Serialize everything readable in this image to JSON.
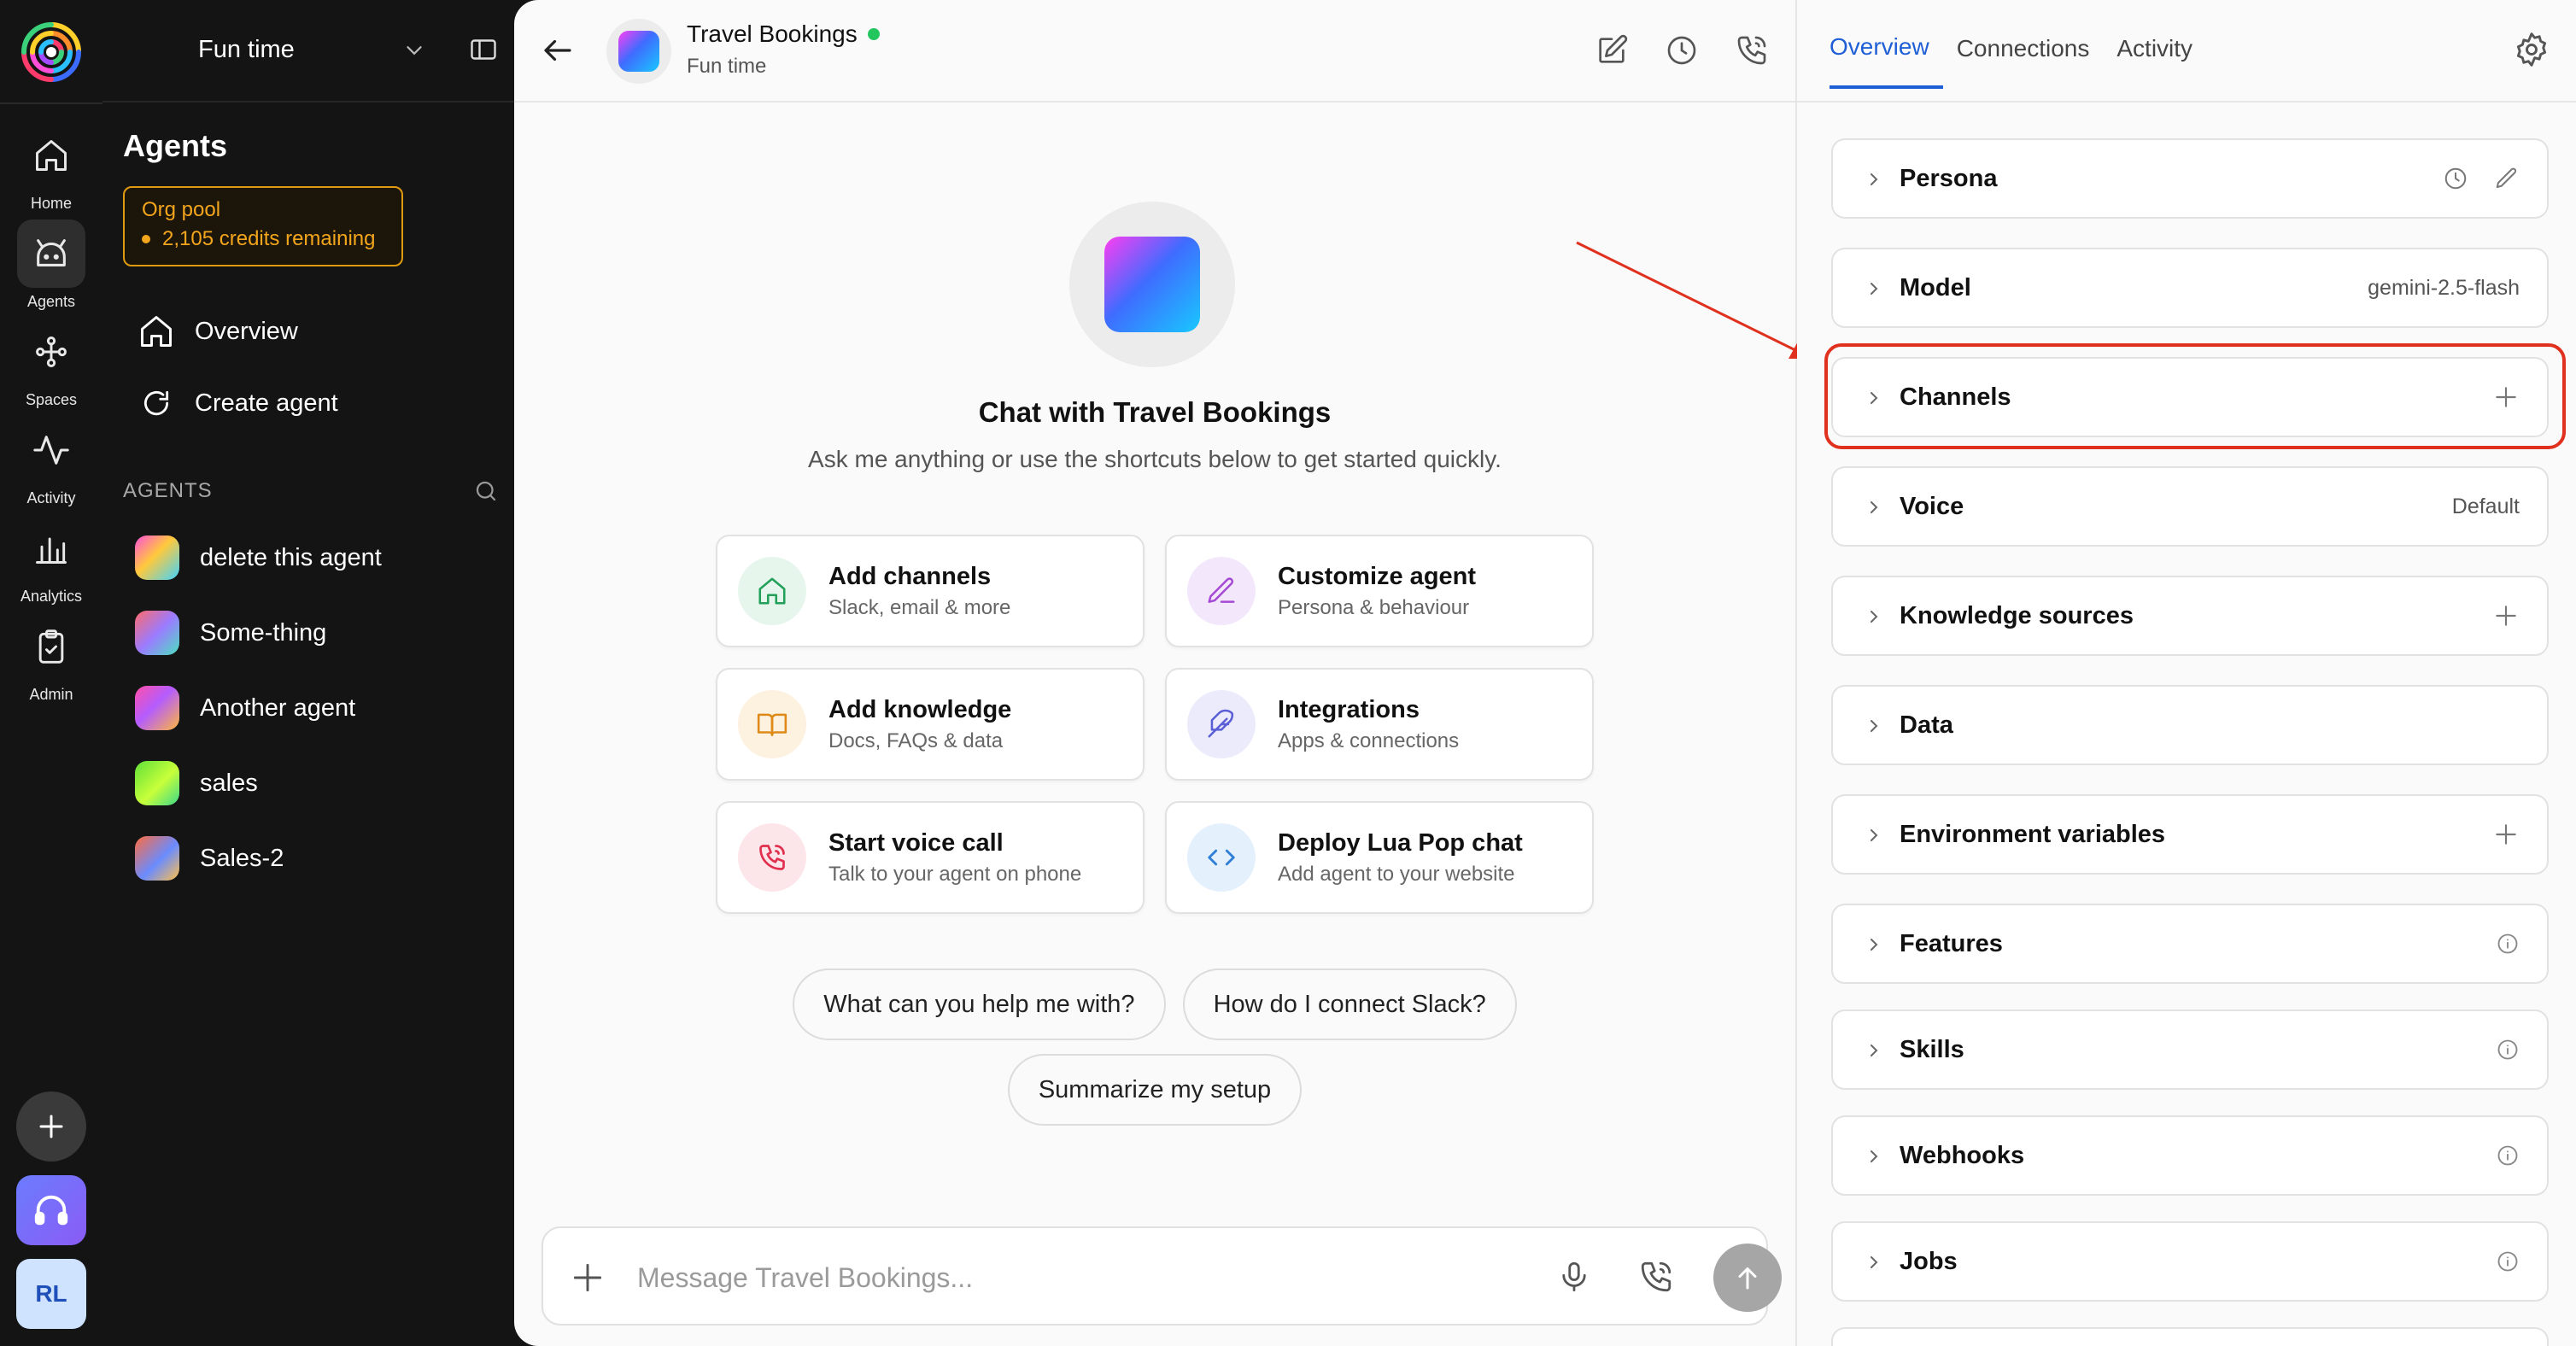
{
  "workspace": {
    "name": "Fun time"
  },
  "rail": {
    "items": [
      {
        "label": "Home",
        "icon": "home-icon"
      },
      {
        "label": "Agents",
        "icon": "bot-icon"
      },
      {
        "label": "Spaces",
        "icon": "spaces-icon"
      },
      {
        "label": "Activity",
        "icon": "activity-icon"
      },
      {
        "label": "Analytics",
        "icon": "bar-chart-icon"
      },
      {
        "label": "Admin",
        "icon": "clipboard-icon"
      }
    ],
    "avatar_initials": "RL"
  },
  "sidebar": {
    "title": "Agents",
    "org_pool": {
      "title": "Org pool",
      "credits": "2,105 credits remaining"
    },
    "nav": [
      {
        "label": "Overview",
        "icon": "home-icon"
      },
      {
        "label": "Create agent",
        "icon": "refresh-icon"
      }
    ],
    "section_label": "AGENTS",
    "agents": [
      {
        "name": "delete this agent",
        "gradient": "linear-gradient(135deg,#ff4fd8,#ffc93c 45%,#3fd3ff)"
      },
      {
        "name": "Some-thing",
        "gradient": "linear-gradient(135deg,#ff6a6a,#9b7bff 50%,#4ce0c0)"
      },
      {
        "name": "Another agent",
        "gradient": "linear-gradient(135deg,#ff4fa8,#b45cff 45%,#ffb83c)"
      },
      {
        "name": "sales",
        "gradient": "linear-gradient(135deg,#5fe03a,#c8ff3a 55%,#3ad88a)"
      },
      {
        "name": "Sales-2",
        "gradient": "linear-gradient(135deg,#ff6b3d,#6a8bff 55%,#ffc14a)"
      }
    ]
  },
  "chat": {
    "agent_name": "Travel Bookings",
    "workspace": "Fun time",
    "status_color": "#22c55e",
    "hero_title": "Chat with Travel Bookings",
    "hero_subtitle": "Ask me anything or use the shortcuts below to get started quickly.",
    "cards": [
      {
        "title": "Add channels",
        "subtitle": "Slack, email & more",
        "icon": "home-icon",
        "bg": "#e6f6ec",
        "fg": "#22a05a"
      },
      {
        "title": "Customize agent",
        "subtitle": "Persona & behaviour",
        "icon": "pencil-icon",
        "bg": "#f3e8fb",
        "fg": "#a64ad6"
      },
      {
        "title": "Add knowledge",
        "subtitle": "Docs, FAQs & data",
        "icon": "book-icon",
        "bg": "#fdf1df",
        "fg": "#dd8a18"
      },
      {
        "title": "Integrations",
        "subtitle": "Apps & connections",
        "icon": "feather-icon",
        "bg": "#ecebfb",
        "fg": "#5b5fd6"
      },
      {
        "title": "Start voice call",
        "subtitle": "Talk to your agent on phone",
        "icon": "phone-icon",
        "bg": "#fde6ea",
        "fg": "#e0304e"
      },
      {
        "title": "Deploy Lua Pop chat",
        "subtitle": "Add agent to your website",
        "icon": "code-icon",
        "bg": "#e4f1fd",
        "fg": "#2f7fd6"
      }
    ],
    "chips_row1": [
      "What can you help me with?",
      "How do I connect Slack?"
    ],
    "chips_row2": [
      "Summarize my setup"
    ],
    "composer_placeholder": "Message Travel Bookings..."
  },
  "right_panel": {
    "tabs": [
      "Overview",
      "Connections",
      "Activity"
    ],
    "active_tab": "Overview",
    "sections": [
      {
        "title": "Persona",
        "right": "",
        "icons": [
          "history-icon",
          "pencil-icon"
        ]
      },
      {
        "title": "Model",
        "right": "gemini-2.5-flash",
        "icons": []
      },
      {
        "title": "Channels",
        "right": "",
        "icons": [
          "plus-icon"
        ]
      },
      {
        "title": "Voice",
        "right": "Default",
        "icons": []
      },
      {
        "title": "Knowledge sources",
        "right": "",
        "icons": [
          "plus-icon"
        ]
      },
      {
        "title": "Data",
        "right": "",
        "icons": []
      },
      {
        "title": "Environment variables",
        "right": "",
        "icons": [
          "plus-icon"
        ]
      },
      {
        "title": "Features",
        "right": "",
        "icons": [
          "info-icon"
        ]
      },
      {
        "title": "Skills",
        "right": "",
        "icons": [
          "info-icon"
        ]
      },
      {
        "title": "Webhooks",
        "right": "",
        "icons": [
          "info-icon"
        ]
      },
      {
        "title": "Jobs",
        "right": "",
        "icons": [
          "info-icon"
        ]
      }
    ],
    "highlighted_section": "Channels",
    "highlight_color": "#e0301e"
  }
}
